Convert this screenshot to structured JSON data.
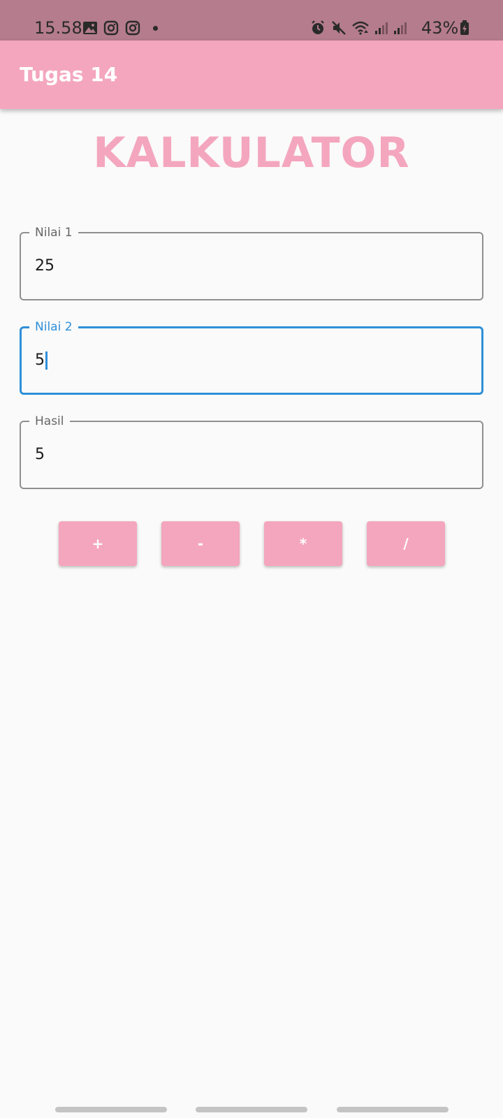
{
  "status_bar": {
    "time": "15.58",
    "battery": "43%",
    "icons": [
      "gallery-icon",
      "instagram-icon",
      "instagram-icon",
      "alarm-icon",
      "mute-icon",
      "wifi-icon",
      "signal-icon",
      "signal-icon",
      "battery-icon"
    ]
  },
  "app_bar": {
    "title": "Tugas 14"
  },
  "heading": "KALKULATOR",
  "fields": {
    "nilai1": {
      "label": "Nilai 1",
      "value": "25"
    },
    "nilai2": {
      "label": "Nilai 2",
      "value": "5"
    },
    "hasil": {
      "label": "Hasil",
      "value": "5"
    }
  },
  "buttons": {
    "add": "+",
    "subtract": "-",
    "multiply": "*",
    "divide": "/"
  },
  "colors": {
    "accent": "#f4a6bf",
    "status_bar": "#b47c8d",
    "focus": "#2f8fd8",
    "background": "#fafafa"
  }
}
